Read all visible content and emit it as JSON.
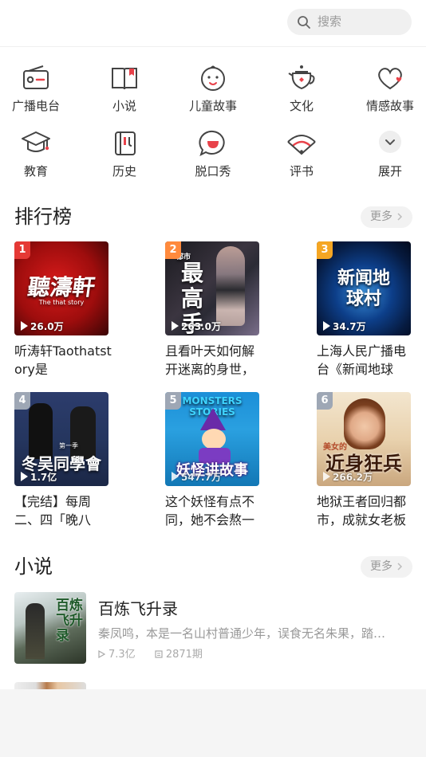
{
  "search": {
    "placeholder": "搜索"
  },
  "categories": [
    {
      "label": "广播电台",
      "icon": "radio-icon"
    },
    {
      "label": "小说",
      "icon": "book-icon"
    },
    {
      "label": "儿童故事",
      "icon": "baby-face-icon"
    },
    {
      "label": "文化",
      "icon": "teapot-icon"
    },
    {
      "label": "情感故事",
      "icon": "heart-icon"
    },
    {
      "label": "教育",
      "icon": "graduation-cap-icon"
    },
    {
      "label": "历史",
      "icon": "history-scroll-icon"
    },
    {
      "label": "脱口秀",
      "icon": "talk-bubble-icon"
    },
    {
      "label": "评书",
      "icon": "folding-fan-icon"
    },
    {
      "label": "展开",
      "icon": "expand-chevron-icon"
    }
  ],
  "ranking": {
    "title": "排行榜",
    "more": "更多",
    "items": [
      {
        "rank": "1",
        "plays": "26.0万",
        "title": "听涛轩Taothatstory是",
        "cover_text": "聽濤軒",
        "cover_sub": "The that story"
      },
      {
        "rank": "2",
        "plays": "263.0万",
        "title": "且看叶天如何解开迷离的身世，",
        "cover_text": "最高手",
        "cover_sub": "都市"
      },
      {
        "rank": "3",
        "plays": "34.7万",
        "title": "上海人民广播电台《新闻地球",
        "cover_text": "新闻地球村",
        "cover_sub": ""
      },
      {
        "rank": "4",
        "plays": "1.7亿",
        "title": "【完结】每周二、四「晚八",
        "cover_text": "冬吴同學會",
        "cover_sub": "第一季"
      },
      {
        "rank": "5",
        "plays": "547.7万",
        "title": "这个妖怪有点不同，她不会熬一",
        "cover_text": "妖怪讲故事",
        "cover_sub": "MONSTERS STORIES"
      },
      {
        "rank": "6",
        "plays": "266.2万",
        "title": "地狱王者回归都市，成就女老板",
        "cover_text": "近身狂兵",
        "cover_sub": "美女的"
      }
    ]
  },
  "novels": {
    "title": "小说",
    "more": "更多",
    "items": [
      {
        "title": "百炼飞升录",
        "desc": "秦凤鸣，本是一名山村普通少年，误食无名朱果，踏…",
        "plays": "7.3亿",
        "episodes": "2871期",
        "cover_text": "百炼飞升录"
      }
    ]
  },
  "colors": {
    "rank1": "#e53935",
    "rank2": "#ff8a3d",
    "rank3": "#f5a623",
    "rank_other": "#9ea7b5",
    "accent": "#e8424a"
  }
}
